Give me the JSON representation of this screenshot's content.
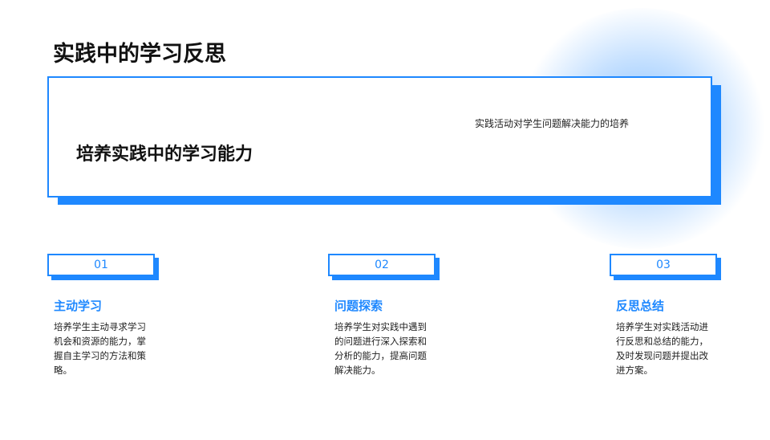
{
  "title": "实践中的学习反思",
  "hero": {
    "subtitle": "实践活动对学生问题解决能力的培养",
    "heading": "培养实践中的学习能力"
  },
  "steps": [
    {
      "number": "01",
      "title": "主动学习",
      "text": "培养学生主动寻求学习机会和资源的能力，掌握自主学习的方法和策略。"
    },
    {
      "number": "02",
      "title": "问题探索",
      "text": "培养学生对实践中遇到的问题进行深入探索和分析的能力，提高问题解决能力。"
    },
    {
      "number": "03",
      "title": "反思总结",
      "text": "培养学生对实践活动进行反思和总结的能力，及时发现问题并提出改进方案。"
    }
  ],
  "colors": {
    "accent": "#1e88ff",
    "text": "#111111",
    "background": "#ffffff"
  }
}
